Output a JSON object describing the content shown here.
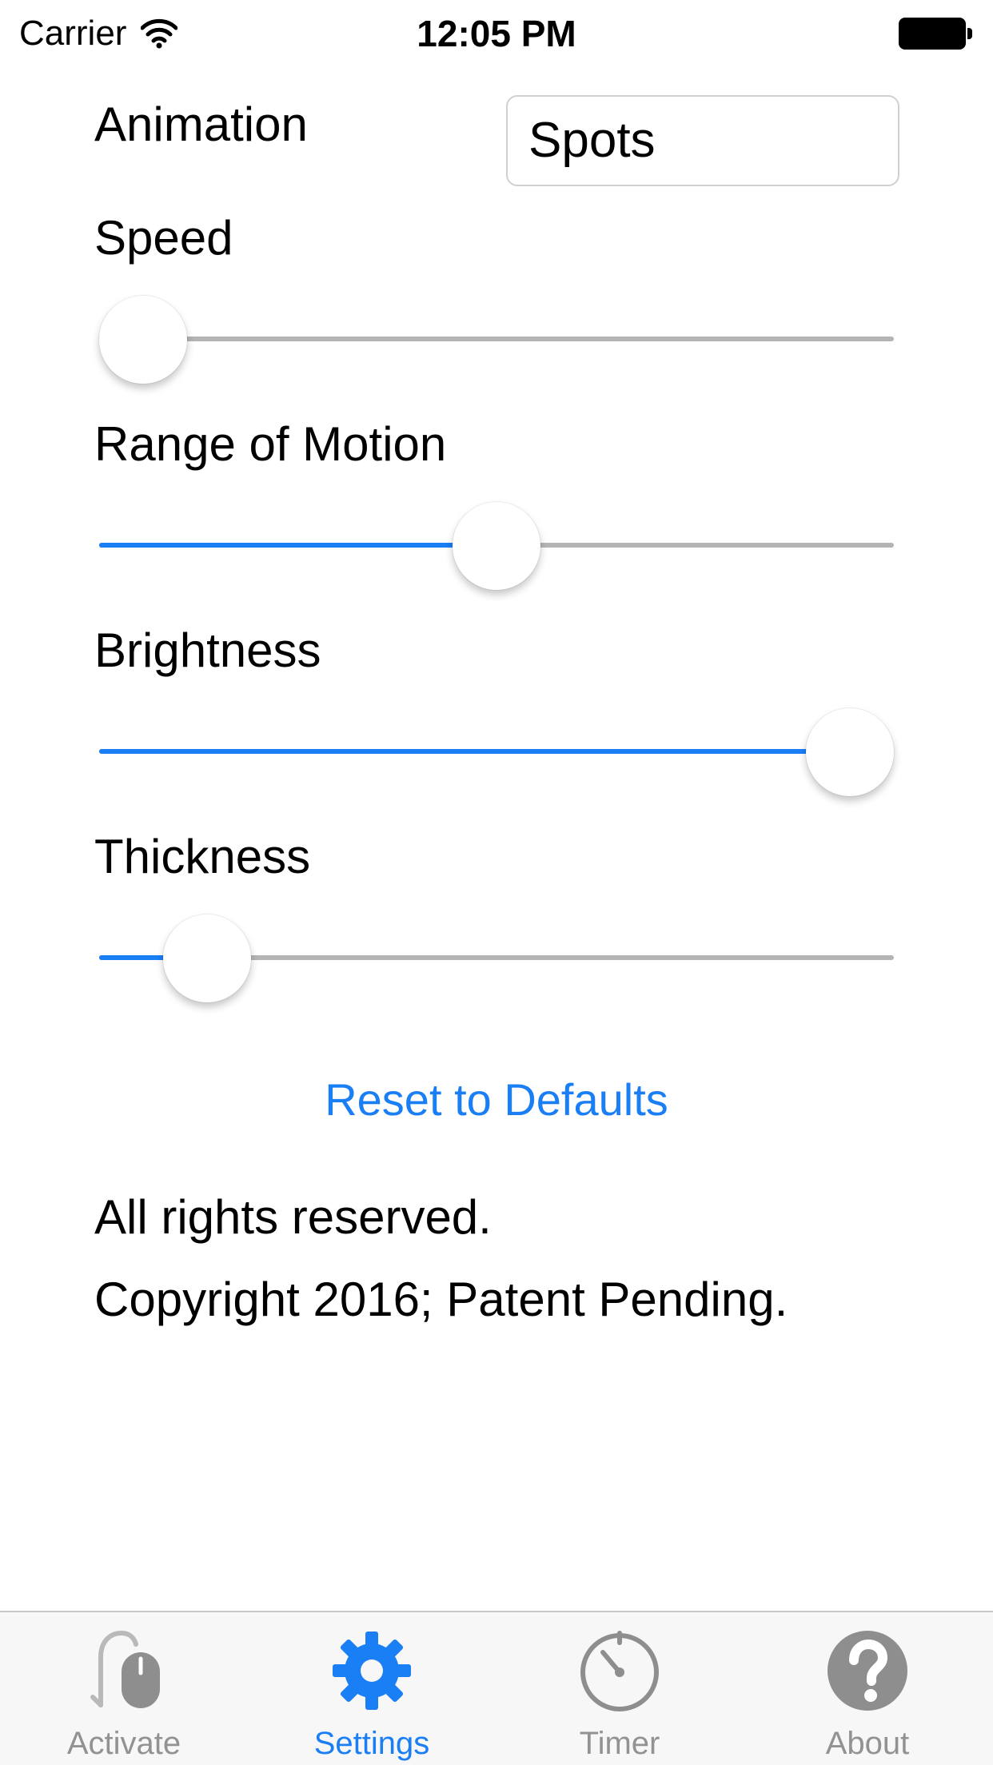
{
  "status_bar": {
    "carrier": "Carrier",
    "time": "12:05 PM"
  },
  "settings": {
    "animation_label": "Animation",
    "animation_value": "Spots",
    "sliders": [
      {
        "label": "Speed",
        "value": 0.0
      },
      {
        "label": "Range of Motion",
        "value": 0.5
      },
      {
        "label": "Brightness",
        "value": 1.0
      },
      {
        "label": "Thickness",
        "value": 0.09
      }
    ],
    "reset_label": "Reset to Defaults"
  },
  "footer": {
    "line1": "All rights reserved.",
    "line2": "Copyright 2016; Patent Pending."
  },
  "tab_bar": {
    "active_tab": "Settings",
    "tabs": [
      {
        "label": "Activate",
        "icon": "mouse-icon"
      },
      {
        "label": "Settings",
        "icon": "gear-icon"
      },
      {
        "label": "Timer",
        "icon": "timer-icon"
      },
      {
        "label": "About",
        "icon": "question-icon"
      }
    ]
  },
  "colors": {
    "accent": "#1a7ef5",
    "inactive": "#929292",
    "track": "#b4b4b4"
  }
}
